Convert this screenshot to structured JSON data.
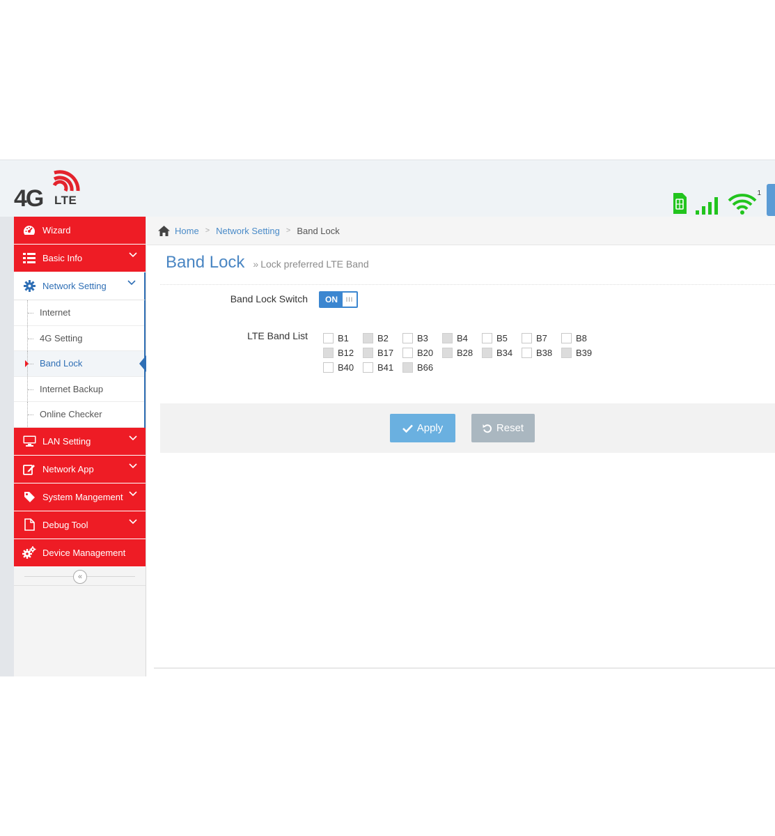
{
  "logo": {
    "big": "4G",
    "small": "LTE"
  },
  "status": {
    "wifi_count": "1",
    "sim_label": "SIM"
  },
  "colors": {
    "brand_red": "#ee1c25",
    "accent_blue": "#2f6fb5",
    "status_green": "#22c41e"
  },
  "sidebar": {
    "items": [
      {
        "label": "Wizard",
        "icon": "dashboard-icon",
        "has_chevron": false
      },
      {
        "label": "Basic Info",
        "icon": "list-icon",
        "has_chevron": true
      },
      {
        "label": "Network Setting",
        "icon": "gear-icon",
        "has_chevron": true,
        "open": true,
        "children": [
          {
            "label": "Internet"
          },
          {
            "label": "4G Setting"
          },
          {
            "label": "Band Lock",
            "active": true
          },
          {
            "label": "Internet Backup"
          },
          {
            "label": "Online Checker"
          }
        ]
      },
      {
        "label": "LAN Setting",
        "icon": "monitor-icon",
        "has_chevron": true
      },
      {
        "label": "Network App",
        "icon": "edit-icon",
        "has_chevron": true
      },
      {
        "label": "System Mangement",
        "icon": "tag-icon",
        "has_chevron": true
      },
      {
        "label": "Debug Tool",
        "icon": "file-icon",
        "has_chevron": true
      },
      {
        "label": "Device Management",
        "icon": "gears-icon",
        "has_chevron": false
      }
    ],
    "collapse_glyph": "«"
  },
  "breadcrumb": {
    "home": "Home",
    "section": "Network Setting",
    "current": "Band Lock"
  },
  "page": {
    "title": "Band Lock",
    "subtitle": "Lock preferred LTE Band"
  },
  "form": {
    "switch_label": "Band Lock Switch",
    "switch_state": "ON",
    "band_list_label": "LTE Band List",
    "bands": [
      {
        "name": "B1",
        "gray": false
      },
      {
        "name": "B2",
        "gray": true
      },
      {
        "name": "B3",
        "gray": false
      },
      {
        "name": "B4",
        "gray": true
      },
      {
        "name": "B5",
        "gray": false
      },
      {
        "name": "B7",
        "gray": false
      },
      {
        "name": "B8",
        "gray": false
      },
      {
        "name": "B12",
        "gray": true
      },
      {
        "name": "B17",
        "gray": true
      },
      {
        "name": "B20",
        "gray": false
      },
      {
        "name": "B28",
        "gray": true
      },
      {
        "name": "B34",
        "gray": true
      },
      {
        "name": "B38",
        "gray": false
      },
      {
        "name": "B39",
        "gray": true
      },
      {
        "name": "B40",
        "gray": false
      },
      {
        "name": "B41",
        "gray": false
      },
      {
        "name": "B66",
        "gray": true
      }
    ]
  },
  "actions": {
    "apply": "Apply",
    "reset": "Reset"
  }
}
